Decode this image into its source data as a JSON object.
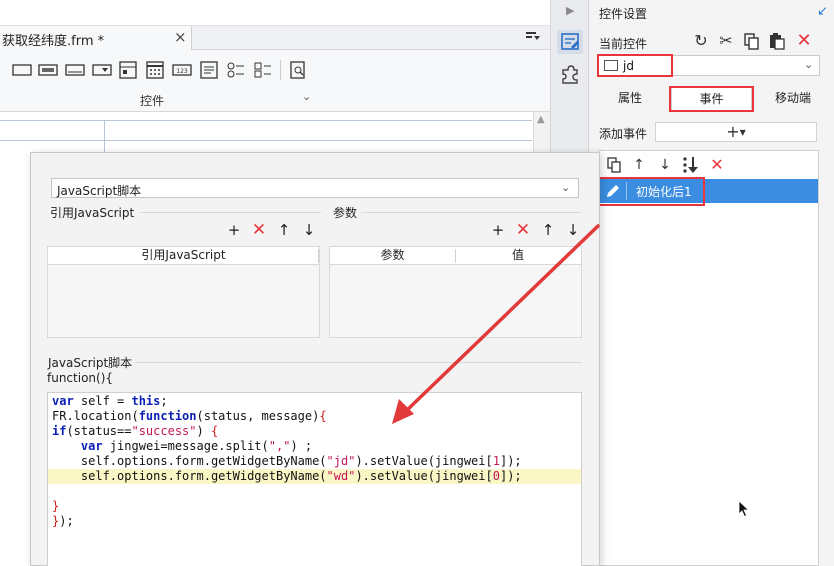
{
  "editor": {
    "file_tab": "获取经纬度.frm *",
    "close_glyph": "×",
    "toolbar_label": "控件",
    "collapse_glyph": "⌄"
  },
  "strip": {
    "arrow_glyph": "▶"
  },
  "panel": {
    "title": "控件设置",
    "current_widget_label": "当前控件",
    "current_widget_value": "jd",
    "tabs": [
      "属性",
      "事件",
      "移动端"
    ],
    "add_event_label": "添加事件",
    "add_event_glyph": "+",
    "event_item": "初始化后1"
  },
  "dialog": {
    "type_value": "JavaScript脚本",
    "ref_js_label": "引用JavaScript",
    "params_label": "参数",
    "ref_table_header": "引用JavaScript",
    "param_headers": [
      "参数",
      "值"
    ],
    "script_label": "JavaScript脚本",
    "function_sig": "function(){"
  },
  "colors": {
    "highlight_red": "#e8343a",
    "selection_blue": "#3a8de1",
    "line_highlight": "#fbf6c6"
  }
}
